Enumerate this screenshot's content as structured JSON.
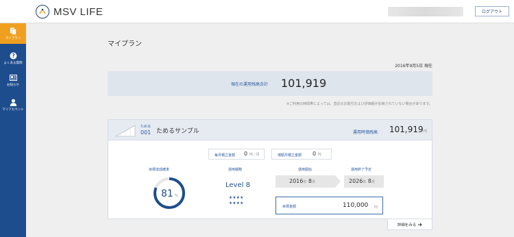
{
  "header": {
    "app_name": "MSV LIFE",
    "logout_label": "ログアウト"
  },
  "sidebar": {
    "items": [
      {
        "label": "マイプラン",
        "icon": "document-icon",
        "active": true
      },
      {
        "label": "よくある質問",
        "icon": "question-icon",
        "active": false
      },
      {
        "label": "お知らせ",
        "icon": "news-icon",
        "active": false
      },
      {
        "label": "マイアカウント",
        "icon": "user-icon",
        "active": false
      }
    ]
  },
  "page": {
    "title": "マイプラン",
    "as_of": "2016年9月5日 現在"
  },
  "total": {
    "label": "現在の運用残高合計",
    "value": "101,919",
    "unit": "円"
  },
  "notice": "※ご利用の時間帯によっては、直近のお取引および評価額が反映されていない場合があります。",
  "plan": {
    "tag": "ためる",
    "number": "001",
    "name": "ためるサンプル",
    "balance_label": "運用時価残高",
    "balance_value": "101,919",
    "balance_unit": "円",
    "monthly_label": "毎月積立金額",
    "monthly_value": "0",
    "monthly_unit": "円／月",
    "extra_label": "増額月積立金額",
    "extra_value": "0",
    "extra_unit": "円",
    "achievement_label": "目標達成確率",
    "achievement_value": "81",
    "achievement_unit": "%",
    "achievement_fraction": 0.81,
    "strategy_label": "運用戦略",
    "strategy_value": "Level 8",
    "stars_row1": "★★★★",
    "stars_row2": "★★★★",
    "start_label": "運用開始",
    "start_year": "2016",
    "start_year_unit": "年",
    "start_month": "8",
    "start_month_unit": "月",
    "end_label": "運用終了予定",
    "end_year": "2026",
    "end_year_unit": "年",
    "end_month": "8",
    "end_month_unit": "月",
    "target_label": "目標金額",
    "target_value": "110,000",
    "target_unit": "円",
    "detail_label": "詳細をみる"
  },
  "colors": {
    "brand": "#1e4d8e",
    "accent": "#f0a020"
  }
}
